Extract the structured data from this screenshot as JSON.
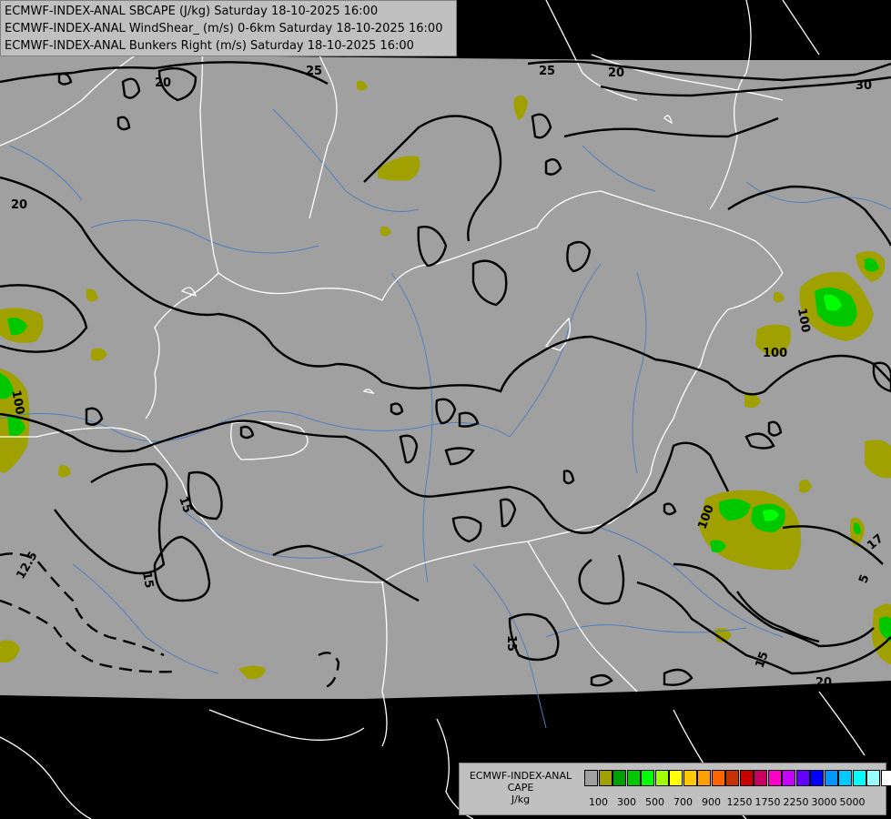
{
  "titles": {
    "line1": "ECMWF-INDEX-ANAL SBCAPE (J/kg) Saturday 18-10-2025 16:00",
    "line2": "ECMWF-INDEX-ANAL WindShear_ (m/s) 0-6km Saturday 18-10-2025 16:00",
    "line3": "ECMWF-INDEX-ANAL Bunkers Right (m/s) Saturday 18-10-2025 16:00"
  },
  "legend": {
    "line1": "ECMWF-INDEX-ANAL",
    "line2": "CAPE",
    "line3": "J/kg",
    "colors": [
      "#a0a0a0",
      "#a0a000",
      "#00a000",
      "#00c800",
      "#00ff00",
      "#a0ff00",
      "#ffff00",
      "#ffc800",
      "#ffa000",
      "#ff6400",
      "#c83200",
      "#c80000",
      "#c80064",
      "#ff00c8",
      "#c800ff",
      "#6400ff",
      "#0000ff",
      "#0096ff",
      "#00c8ff",
      "#00ffff",
      "#96ffff",
      "#ffffff"
    ],
    "ticks": [
      "100",
      "300",
      "500",
      "700",
      "900",
      "1250",
      "1750",
      "2250",
      "3000",
      "5000"
    ]
  },
  "contour_labels": {
    "l25a": "25",
    "l25b": "25",
    "l20a": "20",
    "l20b": "20",
    "l30": "30",
    "l20c": "20",
    "l100a": "100",
    "l100b": "100",
    "l100c": "100",
    "l100d": "100",
    "l15a": "15",
    "l15b": "15",
    "l15c": "15",
    "l15d": "15",
    "l125": "12.5",
    "l17": "17",
    "l15e": "15",
    "l20d": "20",
    "l5": "5"
  }
}
